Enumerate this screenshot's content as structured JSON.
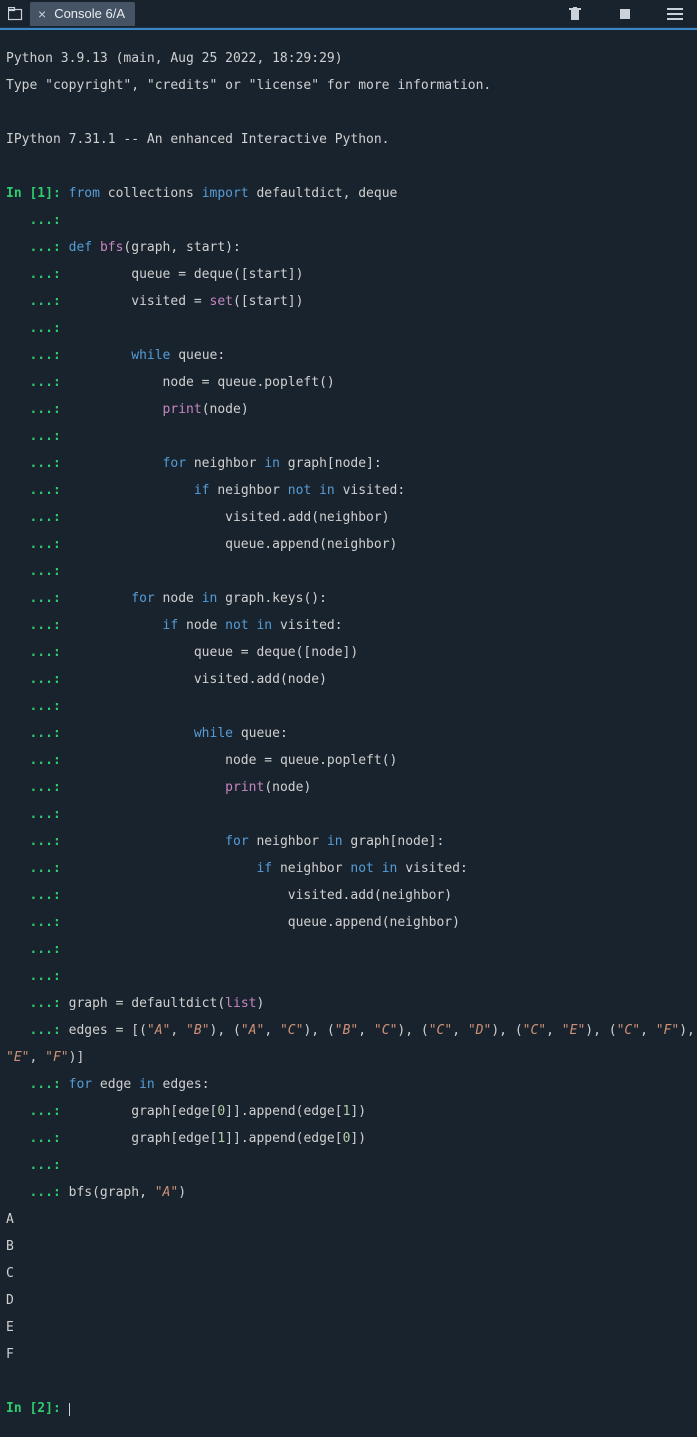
{
  "tab": {
    "label": "Console 6/A"
  },
  "header": {
    "line1": "Python 3.9.13 (main, Aug 25 2022, 18:29:29)",
    "line2": "Type \"copyright\", \"credits\" or \"license\" for more information.",
    "line3": "IPython 7.31.1 -- An enhanced Interactive Python."
  },
  "prompts": {
    "in1": "In [1]: ",
    "in2": "In [2]: ",
    "cont": "   ...: "
  },
  "tokens": {
    "from": "from",
    "import": "import",
    "def": "def",
    "while": "while",
    "for": "for",
    "if": "if",
    "not": "not",
    "in": "in",
    "print": "print",
    "set": "set",
    "list": "list",
    "collections": " collections ",
    "defaultdict_deque": " defaultdict, deque",
    "bfs": "bfs",
    "bfs_args": "(graph, start):",
    "queue_eq_deque_start": "        queue = deque([start])",
    "visited_eq_set_start_a": "        visited = ",
    "visited_eq_set_start_b": "([start])",
    "while_queue": " queue:",
    "node_eq_popleft": "            node = queue.popleft()",
    "print_node_a": "            ",
    "print_node_b": "(node)",
    "for_neighbor": " neighbor ",
    "in_graph_node": " graph[node]:",
    "if_neighbor": " neighbor ",
    "not_in_visited": " visited:",
    "visited_add_neighbor": "                    visited.add(neighbor)",
    "queue_append_neighbor": "                    queue.append(neighbor)",
    "for_node": " node ",
    "in_graph_keys": " graph.keys():",
    "if_node": " node ",
    "queue_eq_deque_node": "                queue = deque([node])",
    "visited_add_node": "                visited.add(node)",
    "node_eq_popleft2": "                    node = queue.popleft()",
    "print_node2_a": "                    ",
    "print_node2_b": "(node)",
    "visited_add_neighbor2": "                            visited.add(neighbor)",
    "queue_append_neighbor2": "                            queue.append(neighbor)",
    "graph_eq_defaultdict_a": "graph = defaultdict(",
    "graph_eq_defaultdict_b": ")",
    "edges_eq_a": "edges = [(",
    "strA": "\"A\"",
    "strB": "\"B\"",
    "strC": "\"C\"",
    "strD": "\"D\"",
    "strE": "\"E\"",
    "strF": "\"F\"",
    "comma_sp": ", ",
    "close_pair_open": "), (",
    "edges_wrap_close": ")]",
    "for_edge": " edge ",
    "in_edges": " edges:",
    "graph_edge0_append_edge1_a": "        graph[edge[",
    "graph_edge0_append_edge1_b": "]].append(edge[",
    "graph_edge0_append_edge1_c": "])",
    "num0": "0",
    "num1": "1",
    "bfs_call_a": "bfs(graph, ",
    "bfs_call_b": ")"
  },
  "output": [
    "A",
    "B",
    "C",
    "D",
    "E",
    "F"
  ]
}
